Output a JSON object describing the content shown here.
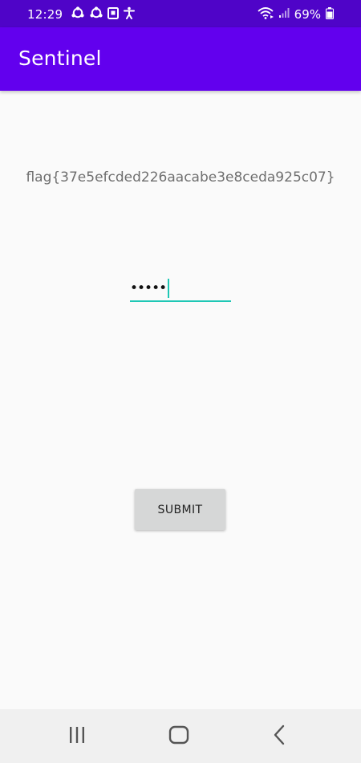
{
  "status_bar": {
    "time": "12:29",
    "battery_percent": "69%",
    "left_icons": [
      "sync-icon",
      "sync-icon",
      "screenshot-icon",
      "accessibility-icon"
    ],
    "right_icons": [
      "wifi-icon",
      "signal-icon",
      "battery-icon"
    ],
    "color": "#4f04c8"
  },
  "app_bar": {
    "title": "Sentinel",
    "color": "#6200ee"
  },
  "main": {
    "flag_text": "flag{37e5efcded226aacabe3e8ceda925c07}",
    "password": {
      "value": "•••••",
      "accent_color": "#1ec7b5"
    },
    "submit_label": "SUBMIT"
  },
  "nav_bar": {
    "buttons": [
      "recent-apps-icon",
      "home-icon",
      "back-icon"
    ]
  }
}
